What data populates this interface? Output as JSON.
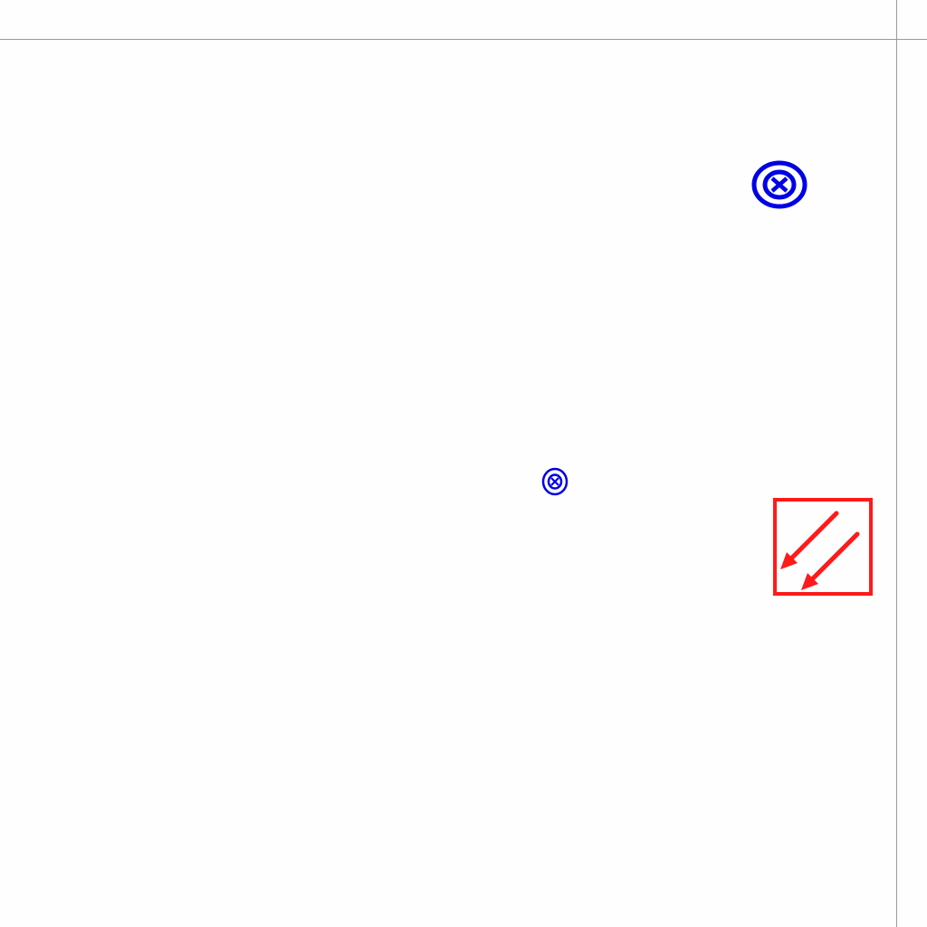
{
  "canvas": {
    "background": "#fefefe",
    "rule_color": "#9a9a9a"
  },
  "markers": [
    {
      "icon": "circled-x-target-icon",
      "color": "#0000e6",
      "size": "large"
    },
    {
      "icon": "circled-x-target-icon",
      "color": "#0000e6",
      "size": "small"
    }
  ],
  "arrow_box": {
    "icon": "double-arrow-down-left-icon",
    "color": "#ff1a1a"
  }
}
